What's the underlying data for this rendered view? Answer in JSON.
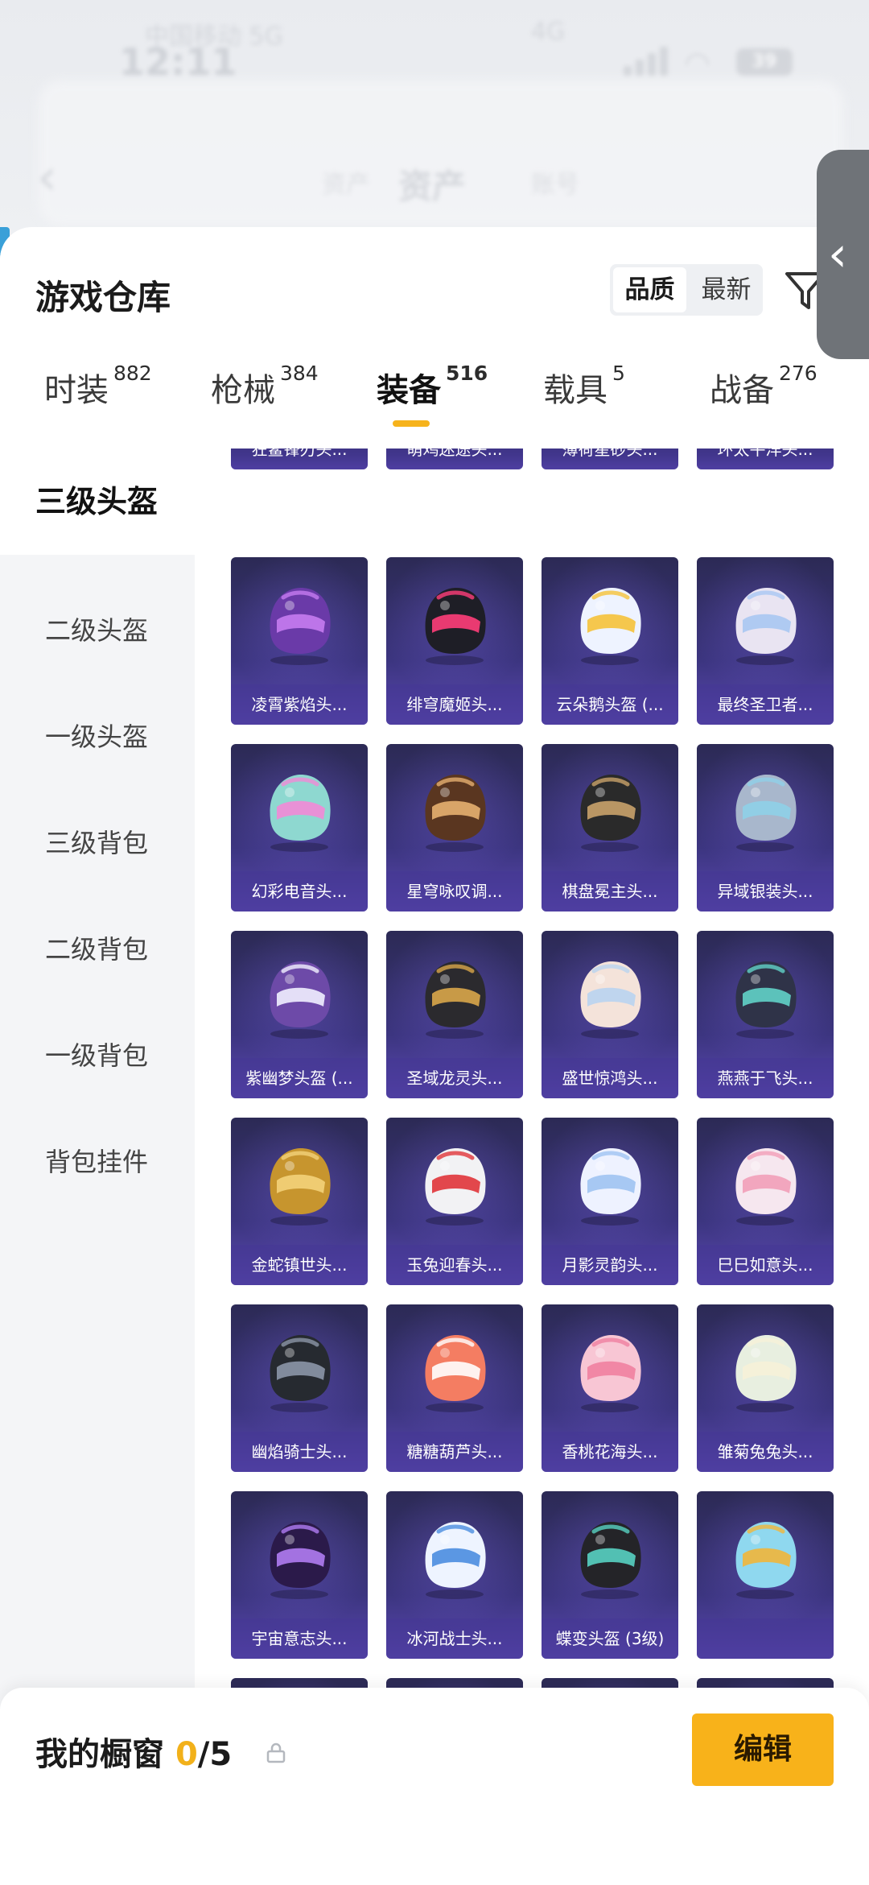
{
  "status_bar": {
    "time": "12:11",
    "carrier": "中国移动 5G",
    "carrier2": "4G",
    "battery": "39"
  },
  "background_nav": {
    "title": "资产",
    "left_tab": "资产",
    "right_tab": "账号"
  },
  "header": {
    "title": "游戏仓库",
    "sort_options": [
      "品质",
      "最新"
    ],
    "sort_selected": "品质"
  },
  "tabs": [
    {
      "label": "时装",
      "count": "882"
    },
    {
      "label": "枪械",
      "count": "384"
    },
    {
      "label": "装备",
      "count": "516",
      "active": true
    },
    {
      "label": "载具",
      "count": "5"
    },
    {
      "label": "战备",
      "count": "276"
    }
  ],
  "side_items": [
    "三级头盔",
    "二级头盔",
    "一级头盔",
    "三级背包",
    "二级背包",
    "一级背包",
    "背包挂件"
  ],
  "top_partial_labels": [
    "狂鲨锋刃头...",
    "萌鸡迷途头...",
    "薄荷星砂头...",
    "环太平洋头..."
  ],
  "items": [
    "凌霄紫焰头...",
    "绯穹魔姬头...",
    "云朵鹅头盔 (...",
    "最终圣卫者...",
    "幻彩电音头...",
    "星穹咏叹调...",
    "棋盘冕主头...",
    "异域银装头...",
    "紫幽梦头盔 (...",
    "圣域龙灵头...",
    "盛世惊鸿头...",
    "燕燕于飞头...",
    "金蛇镇世头...",
    "玉兔迎春头...",
    "月影灵韵头...",
    "巳巳如意头...",
    "幽焰骑士头...",
    "糖糖葫芦头...",
    "香桃花海头...",
    "雏菊兔兔头...",
    "宇宙意志头...",
    "冰河战士头...",
    "蝶变头盔 (3级)",
    ""
  ],
  "helmet_colors": [
    [
      "#6a3aa8",
      "#c67cf0"
    ],
    [
      "#1e1e26",
      "#ff3d7a"
    ],
    [
      "#eef3ff",
      "#f5c23a"
    ],
    [
      "#e9e4f2",
      "#a9c7f2"
    ],
    [
      "#8ed8d0",
      "#f28ad6"
    ],
    [
      "#5a3620",
      "#e6b070"
    ],
    [
      "#2a2a2a",
      "#c9a26a"
    ],
    [
      "#a8b7cc",
      "#8ed0e8"
    ],
    [
      "#6d4aa8",
      "#f1f0ff"
    ],
    [
      "#2b2a2e",
      "#d9a64a"
    ],
    [
      "#f4e3da",
      "#b9d3ef"
    ],
    [
      "#2f3348",
      "#62d2c8"
    ],
    [
      "#c7952e",
      "#f3d27a"
    ],
    [
      "#f2f2f4",
      "#e0343a"
    ],
    [
      "#eef2ff",
      "#9fc3f2"
    ],
    [
      "#f6e7ef",
      "#f29fb8"
    ],
    [
      "#262a30",
      "#8c96a8"
    ],
    [
      "#f47d62",
      "#ffffff"
    ],
    [
      "#f8c6d4",
      "#ef7fa0"
    ],
    [
      "#e8efe0",
      "#f6f1d8"
    ],
    [
      "#2b1a4a",
      "#b07cf2"
    ],
    [
      "#eef4ff",
      "#4a8de0"
    ],
    [
      "#242428",
      "#58d2c2"
    ],
    [
      "#8fd8ef",
      "#f1b63a"
    ]
  ],
  "bottom_partial_colors": [
    "#a8dcef",
    "#f3e5d8",
    "#e9e6f2",
    "#f6d8e2"
  ],
  "showcase": {
    "label": "我的橱窗",
    "current": "0",
    "total": "/5"
  },
  "edit_label": "编辑"
}
